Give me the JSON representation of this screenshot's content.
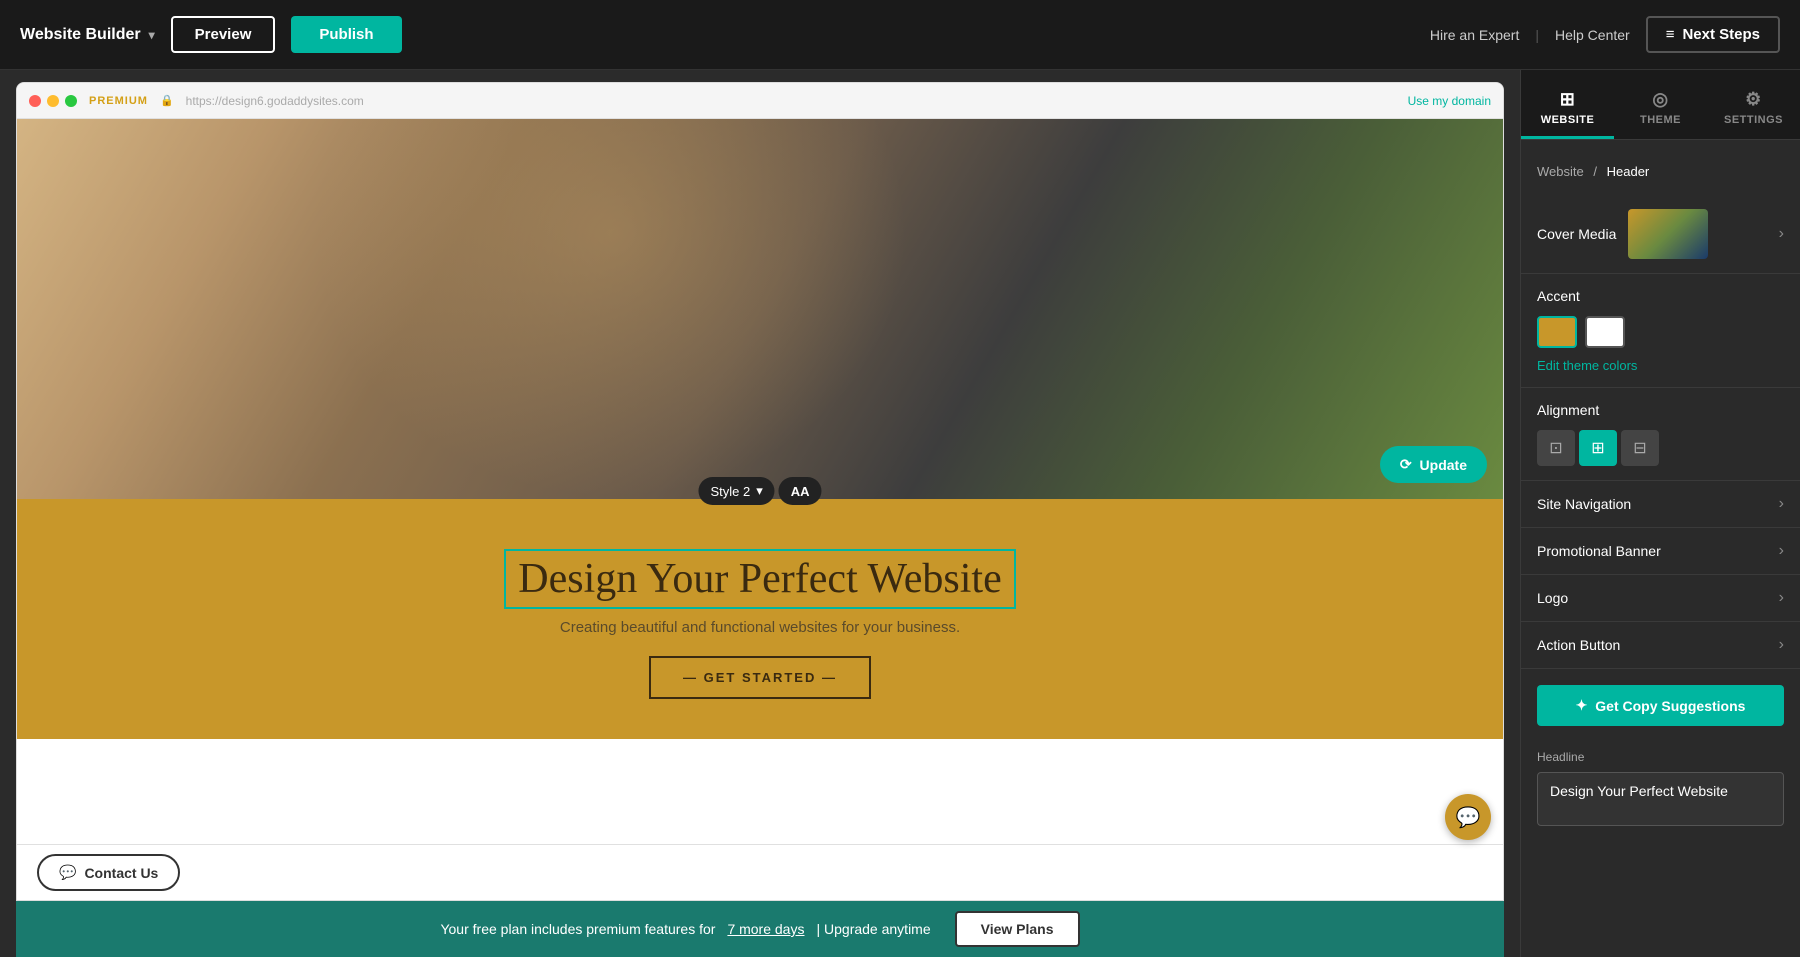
{
  "topBar": {
    "appName": "Website Builder",
    "previewLabel": "Preview",
    "publishLabel": "Publish",
    "hireExpertLabel": "Hire an Expert",
    "helpCenterLabel": "Help Center",
    "nextStepsLabel": "Next Steps"
  },
  "browser": {
    "premiumLabel": "PREMIUM",
    "urlPlaceholder": "https://design6.godaddysites.com",
    "useDomainLabel": "Use my domain"
  },
  "hero": {
    "updateLabel": "Update",
    "styleLabel": "Style 2",
    "headline": "Design Your Perfect Website",
    "subtext": "Creating beautiful and functional websites for your business.",
    "ctaLabel": "GET STARTED"
  },
  "contactBar": {
    "contactUsLabel": "Contact Us"
  },
  "upgradeBanner": {
    "text": "Your free plan includes premium features for",
    "linkText": "7 more days",
    "separator": "| Upgrade anytime",
    "viewPlansLabel": "View Plans"
  },
  "rightPanel": {
    "tabs": [
      {
        "id": "website",
        "label": "WEBSITE",
        "icon": "⊞"
      },
      {
        "id": "theme",
        "label": "THEME",
        "icon": "◎"
      },
      {
        "id": "settings",
        "label": "SETTINGS",
        "icon": "⚙"
      }
    ],
    "breadcrumb": {
      "parent": "Website",
      "separator": "/",
      "current": "Header"
    },
    "sections": {
      "coverMedia": {
        "label": "Cover Media"
      },
      "accent": {
        "label": "Accent",
        "editColorsLabel": "Edit theme colors",
        "colors": [
          {
            "hex": "#c8972a",
            "active": true
          },
          {
            "hex": "#ffffff",
            "active": false
          }
        ]
      },
      "alignment": {
        "label": "Alignment",
        "options": [
          "left",
          "center",
          "right"
        ],
        "active": "center"
      },
      "siteNavigation": {
        "label": "Site Navigation"
      },
      "promotionalBanner": {
        "label": "Promotional Banner"
      },
      "logo": {
        "label": "Logo"
      },
      "actionButton": {
        "label": "Action Button"
      },
      "getCopySuggestions": {
        "label": "Get Copy Suggestions"
      },
      "headline": {
        "label": "Headline",
        "value": "Design Your Perfect Website"
      }
    }
  }
}
